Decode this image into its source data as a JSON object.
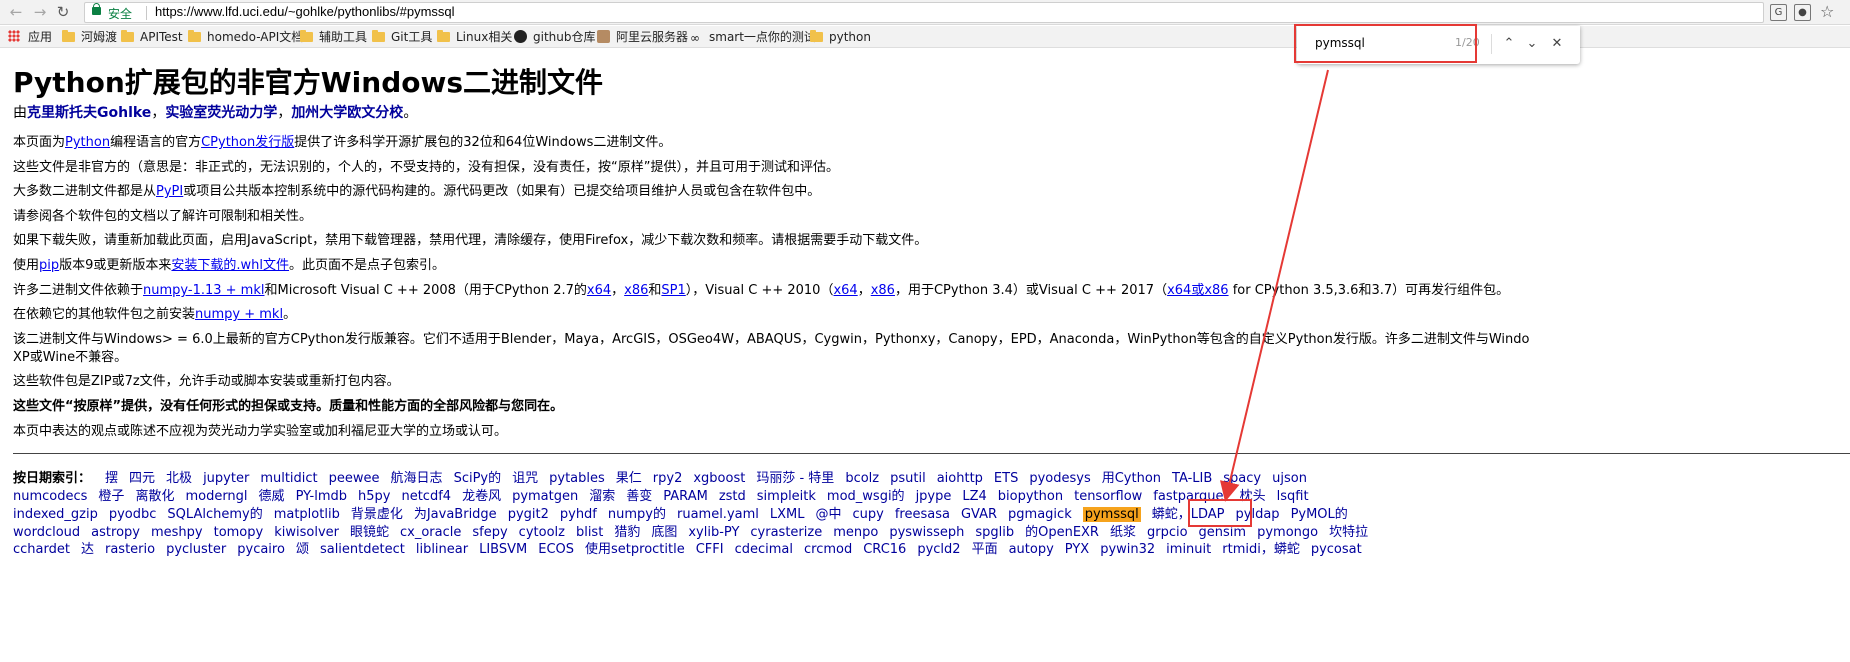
{
  "browser": {
    "url": "https://www.lfd.uci.edu/~gohlke/pythonlibs/#pymssql",
    "secure_label": "安全",
    "find": {
      "query": "pymssql",
      "count": "1/20"
    }
  },
  "bookmarks": [
    {
      "icon": "apps-icon",
      "label": "应用"
    },
    {
      "icon": "folder-icon",
      "label": "河姆渡"
    },
    {
      "icon": "folder-icon",
      "label": "APITest"
    },
    {
      "icon": "folder-icon",
      "label": "homedo-API文档"
    },
    {
      "icon": "folder-icon",
      "label": "辅助工具"
    },
    {
      "icon": "folder-icon",
      "label": "Git工具"
    },
    {
      "icon": "folder-icon",
      "label": "Linux相关"
    },
    {
      "icon": "github-icon",
      "label": "github仓库"
    },
    {
      "icon": "avatar-icon",
      "label": "阿里云服务器"
    },
    {
      "icon": "swirl-icon",
      "label": "smart一点你的测试"
    },
    {
      "icon": "folder-icon",
      "label": "python"
    }
  ],
  "page": {
    "title": "Python扩展包的非官方Windows二进制文件",
    "byline": {
      "prefix": "由",
      "author": "克里斯托夫Gohlke",
      "sep1": "，",
      "lab": "实验室荧光动力学",
      "sep2": "，",
      "univ": "加州大学欧文分校",
      "end": "。"
    },
    "p1": {
      "a": "本页面为",
      "python": "Python",
      "b": "编程语言的官方",
      "cpython": "CPython发行版",
      "c": "提供了许多科学开源扩展包的32位和64位Windows二进制文件。"
    },
    "p2": "这些文件是非官方的（意思是：非正式的，无法识别的，个人的，不受支持的，没有担保，没有责任，按“原样”提供），并且可用于测试和评估。",
    "p3": {
      "a": "大多数二进制文件都是从",
      "pypi": "PyPI",
      "b": "或项目公共版本控制系统中的源代码构建的。源代码更改（如果有）已提交给项目维护人员或包含在软件包中。"
    },
    "p4": "请参阅各个软件包的文档以了解许可限制和相关性。",
    "p5": "如果下载失败，请重新加载此页面，启用JavaScript，禁用下载管理器，禁用代理，清除缓存，使用Firefox，减少下载次数和频率。请根据需要手动下载文件。",
    "p6": {
      "a": "使用",
      "pip": "pip",
      "b": "版本9或更新版本来",
      "whl": "安装下载的.whl文件",
      "c": "。此页面不是点子包索引。"
    },
    "p7": {
      "a": "许多二进制文件依赖于",
      "numpy": "numpy-1.13 + mkl",
      "b": "和Microsoft Visual C ++ 2008（用于CPython 2.7的",
      "x64a": "x64",
      "c": "，",
      "x86a": "x86",
      "d": "和",
      "sp1": "SP1",
      "e": "），Visual C ++ 2010（",
      "x64b": "x64",
      "f": "，",
      "x86b": "x86",
      "g": "，用于CPython 3.4）或Visual C ++ 2017（",
      "x64x86": "x64或x86",
      "h": " for CPython 3.5,3.6和3.7）可再发行组件包。"
    },
    "p8": {
      "a": "在依赖它的其他软件包之前安装",
      "numpy": "numpy + mkl",
      "b": "。"
    },
    "p9a": "该二进制文件与Windows> = 6.0上最新的官方CPython发行版兼容。它们不适用于Blender，Maya，ArcGIS，OSGeo4W，ABAQUS，Cygwin，Pythonxy，Canopy，EPD，Anaconda，WinPython等包含的自定义Python发行版。许多二进制文件与Windo",
    "p9b": "XP或Wine不兼容。",
    "p10": "这些软件包是ZIP或7z文件，允许手动或脚本安装或重新打包内容。",
    "p11": "这些文件“按原样”提供，没有任何形式的担保或支持。质量和性能方面的全部风险都与您同在。",
    "p12": "本页中表达的观点或陈述不应视为荧光动力学实验室或加利福尼亚大学的立场或认可。"
  },
  "index": {
    "label": "按日期索引：",
    "lines": [
      [
        "摆",
        "四元",
        "北极",
        "jupyter",
        "multidict",
        "peewee",
        "航海日志",
        "SciPy的",
        "诅咒",
        "pytables",
        "果仁",
        "rpy2",
        "xgboost",
        "玛丽莎 - 特里",
        "bcolz",
        "psutil",
        "aiohttp",
        "ETS",
        "pyodesys",
        "用Cython",
        "TA-LIB",
        "spacy",
        "ujson"
      ],
      [
        "numcodecs",
        "橙子",
        "离散化",
        "moderngl",
        "德威",
        "PY-lmdb",
        "h5py",
        "netcdf4",
        "龙卷风",
        "pymatgen",
        "溜索",
        "善变",
        "PARAM",
        "zstd",
        "simpleitk",
        "mod_wsgi的",
        "jpype",
        "LZ4",
        "biopython",
        "tensorflow",
        "fastparquet",
        "枕头",
        "lsqfit"
      ],
      [
        "indexed_gzip",
        "pyodbc",
        "SQLAlchemy的",
        "matplotlib",
        "背景虚化",
        "为JavaBridge",
        "pygit2",
        "pyhdf",
        "numpy的",
        "ruamel.yaml",
        "LXML",
        "@中",
        "cupy",
        "freesasa",
        "GVAR",
        "pgmagick",
        "pymssql",
        "蟒蛇，LDAP",
        "pyldap",
        "PyMOL的"
      ],
      [
        "wordcloud",
        "astropy",
        "meshpy",
        "tomopy",
        "kiwisolver",
        "眼镜蛇",
        "cx_oracle",
        "sfepy",
        "cytoolz",
        "blist",
        "猎豹",
        "底图",
        "xylib-PY",
        "cyrasterize",
        "menpo",
        "pyswisseph",
        "spglib",
        "的OpenEXR",
        "纸浆",
        "grpcio",
        "gensim",
        "pymongo",
        "坎特拉"
      ],
      [
        "cchardet",
        "达",
        "rasterio",
        "pycluster",
        "pycairo",
        "颂",
        "salientdetect",
        "liblinear",
        "LIBSVM",
        "ECOS",
        "使用setproctitle",
        "CFFI",
        "cdecimal",
        "crcmod",
        "CRC16",
        "pycld2",
        "平面",
        "autopy",
        "PYX",
        "pywin32",
        "iminuit",
        "rtmidi，蟒蛇",
        "pycosat"
      ]
    ],
    "highlighted": "pymssql"
  },
  "annotation_color": "#e53935",
  "highlight_color": "#f6a31c",
  "link_color": "#00009c"
}
